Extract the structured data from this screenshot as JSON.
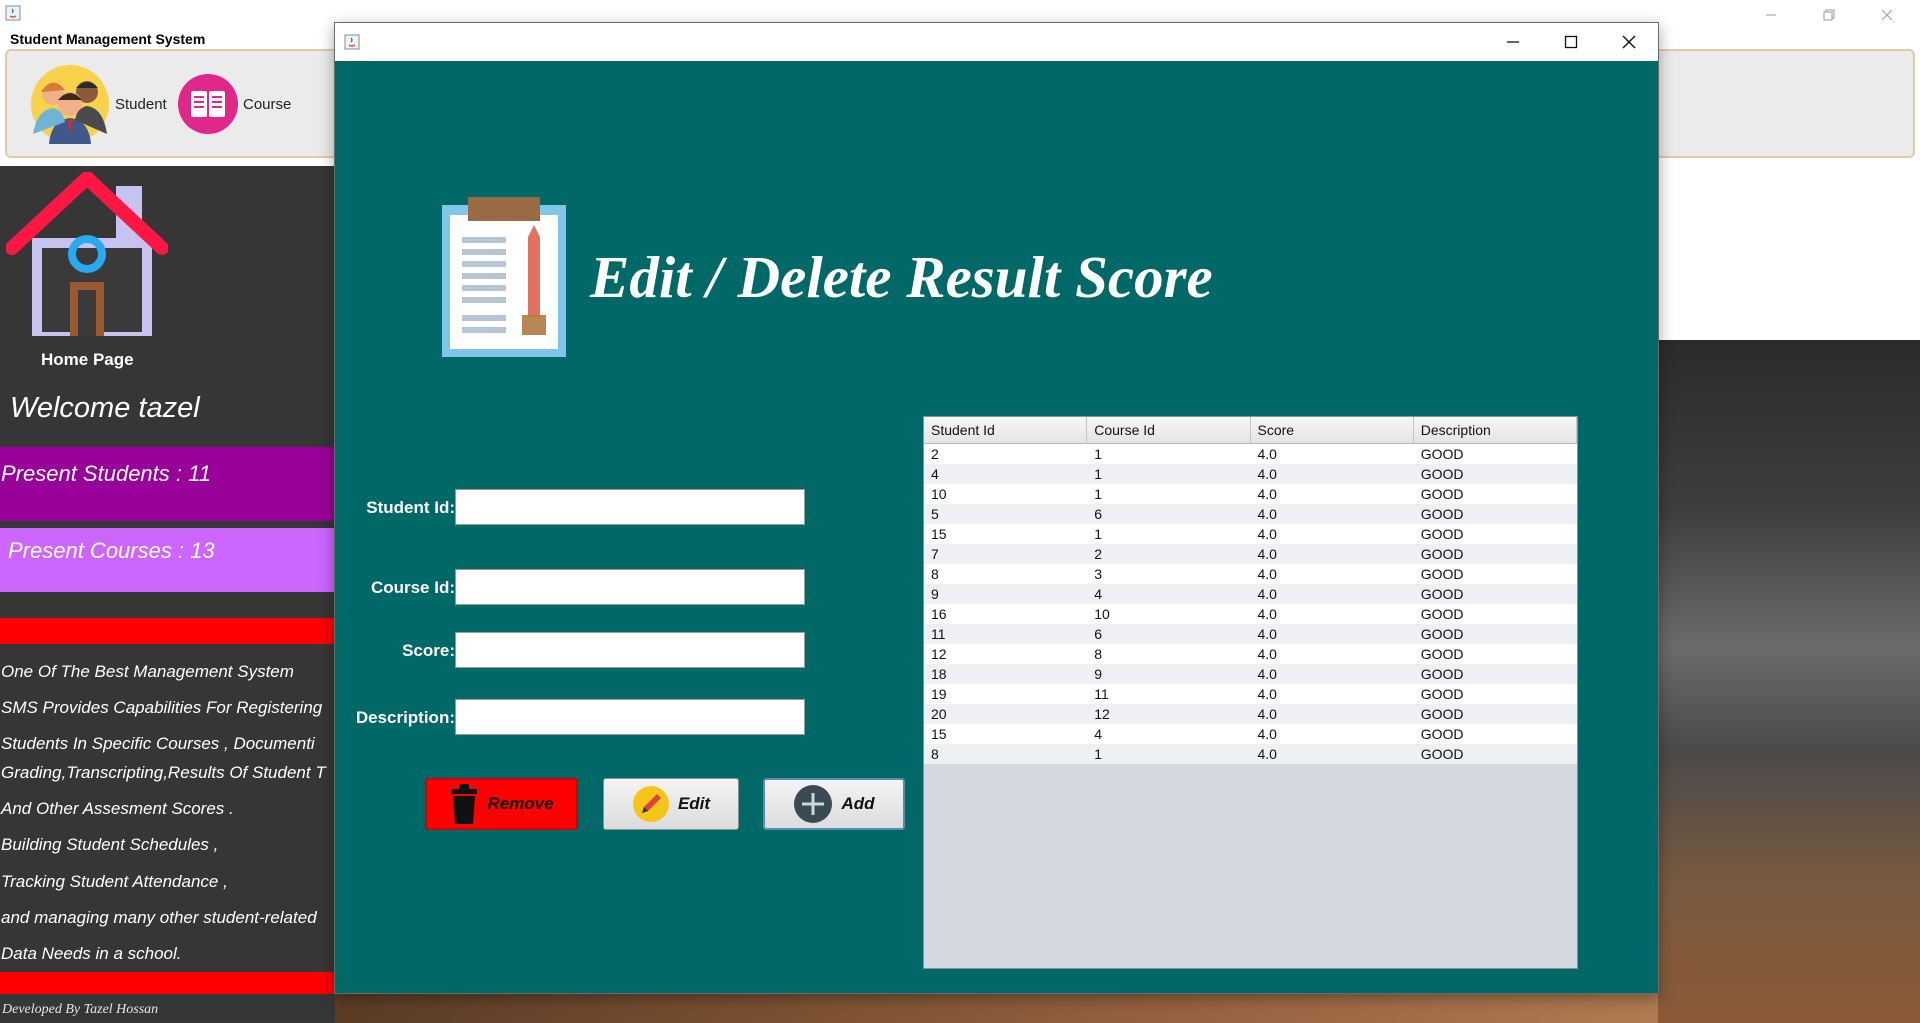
{
  "app": {
    "title": "Student Management System",
    "toolbar": [
      {
        "label": "Student",
        "icon": "students-icon"
      },
      {
        "label": "Course",
        "icon": "book-icon"
      }
    ]
  },
  "sidebar": {
    "home_label": "Home Page",
    "welcome": "Welcome tazel",
    "present_students": "Present Students : 11",
    "present_courses": "Present Courses : 13",
    "description_lines": [
      "One Of The Best Management System",
      "SMS Provides Capabilities For Registering",
      "Students In Specific Courses  , Documenti",
      "Grading,Transcripting,Results Of Student T",
      "And Other Assesment Scores .",
      " Building Student Schedules ,",
      "Tracking Student Attendance ,",
      " and managing many other student-related",
      " Data Needs in a school."
    ],
    "credit": "Developed By Tazel Hossan"
  },
  "dialog": {
    "heading": "Edit / Delete Result Score",
    "form": {
      "student_id_label": "Student Id:",
      "course_id_label": "Course Id:",
      "score_label": "Score:",
      "description_label": "Description:",
      "student_id_value": "",
      "course_id_value": "",
      "score_value": "",
      "description_value": ""
    },
    "buttons": {
      "remove": "Remove",
      "edit": "Edit",
      "add": "Add"
    },
    "table": {
      "columns": [
        "Student Id",
        "Course Id",
        "Score",
        "Description"
      ],
      "rows": [
        [
          "2",
          "1",
          "4.0",
          "GOOD"
        ],
        [
          "4",
          "1",
          "4.0",
          "GOOD"
        ],
        [
          "10",
          "1",
          "4.0",
          "GOOD"
        ],
        [
          "5",
          "6",
          "4.0",
          "GOOD"
        ],
        [
          "15",
          "1",
          "4.0",
          "GOOD"
        ],
        [
          "7",
          "2",
          "4.0",
          "GOOD"
        ],
        [
          "8",
          "3",
          "4.0",
          "GOOD"
        ],
        [
          "9",
          "4",
          "4.0",
          "GOOD"
        ],
        [
          "16",
          "10",
          "4.0",
          "GOOD"
        ],
        [
          "11",
          "6",
          "4.0",
          "GOOD"
        ],
        [
          "12",
          "8",
          "4.0",
          "GOOD"
        ],
        [
          "18",
          "9",
          "4.0",
          "GOOD"
        ],
        [
          "19",
          "11",
          "4.0",
          "GOOD"
        ],
        [
          "20",
          "12",
          "4.0",
          "GOOD"
        ],
        [
          "15",
          "4",
          "4.0",
          "GOOD"
        ],
        [
          "8",
          "1",
          "4.0",
          "GOOD"
        ]
      ]
    }
  },
  "colors": {
    "dialog_bg": "#006866",
    "sidebar_bg": "#363636",
    "students_bar": "#990099",
    "courses_bar": "#cc66ff",
    "red_bar": "#ff0000"
  }
}
